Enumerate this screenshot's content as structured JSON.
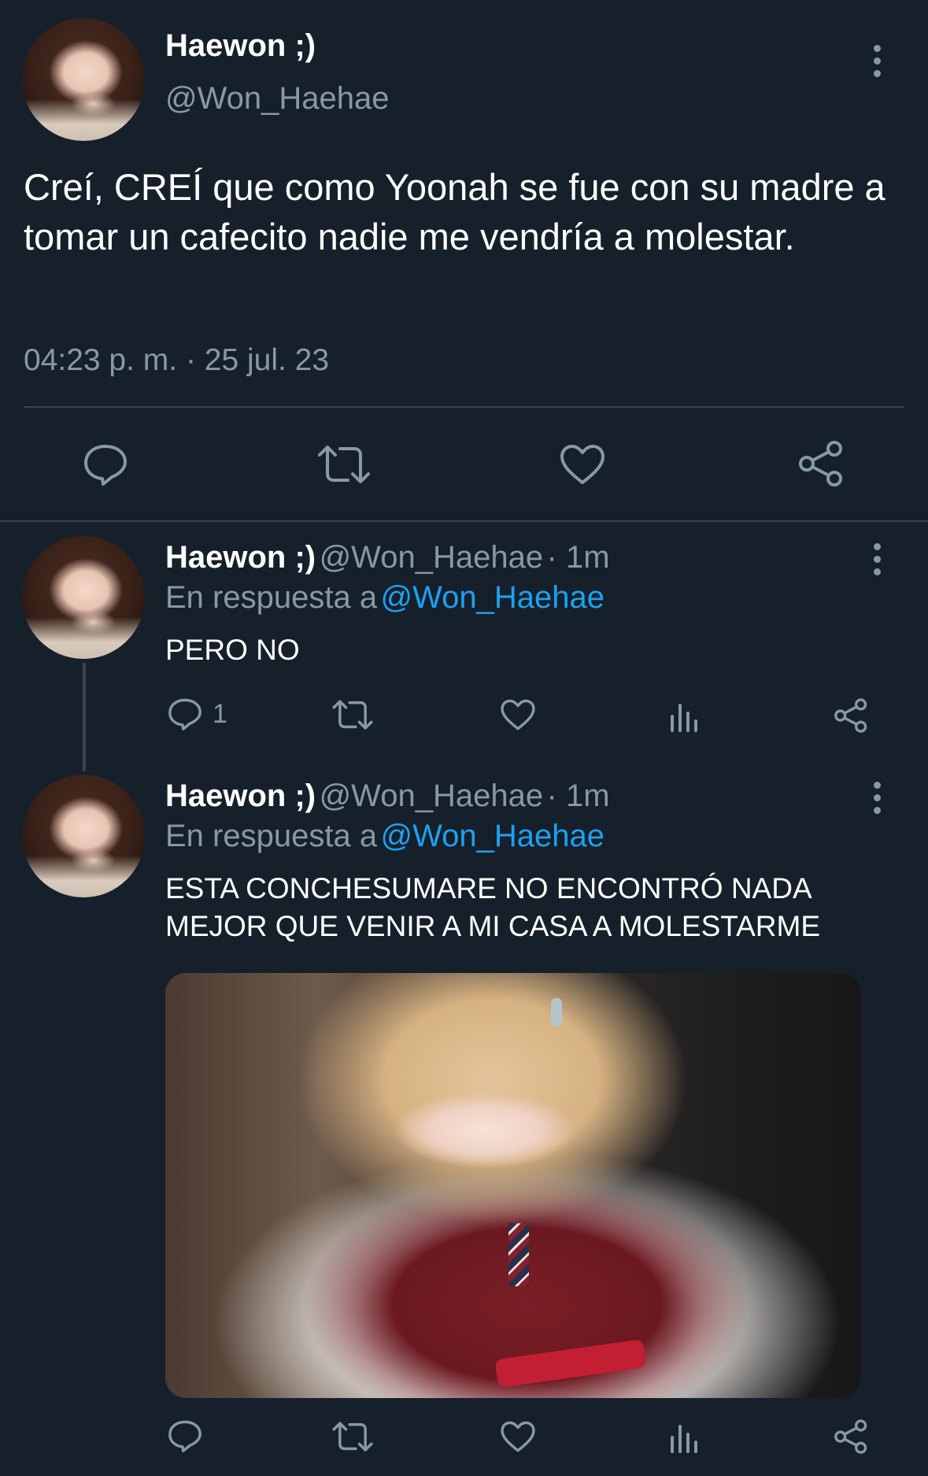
{
  "main_tweet": {
    "name": "Haewon ;)",
    "handle": "@Won_Haehae",
    "text": "Creí, CREÍ que como Yoonah se fue con su madre a tomar un cafecito nadie me vendría a molestar.",
    "timestamp": "04:23 p. m. · 25 jul. 23",
    "actions": [
      "reply-icon",
      "retweet-icon",
      "like-icon",
      "share-icon"
    ]
  },
  "replies": [
    {
      "name": "Haewon ;)",
      "handle": "@Won_Haehae",
      "time": "· 1m",
      "replying_label": "En respuesta a",
      "replying_to": "@Won_Haehae",
      "text": "PERO NO",
      "reply_count": "1"
    },
    {
      "name": "Haewon ;)",
      "handle": "@Won_Haehae",
      "time": "· 1m",
      "replying_label": "En respuesta a",
      "replying_to": "@Won_Haehae",
      "text": "ESTA CONCHESUMARE NO ENCONTRÓ NADA MEJOR QUE VENIR A MI CASA A MOLESTARME",
      "reply_count": ""
    }
  ],
  "colors": {
    "background": "#15202b",
    "secondary_text": "#8899a6",
    "accent": "#1da1f2",
    "divider": "#38444d"
  }
}
